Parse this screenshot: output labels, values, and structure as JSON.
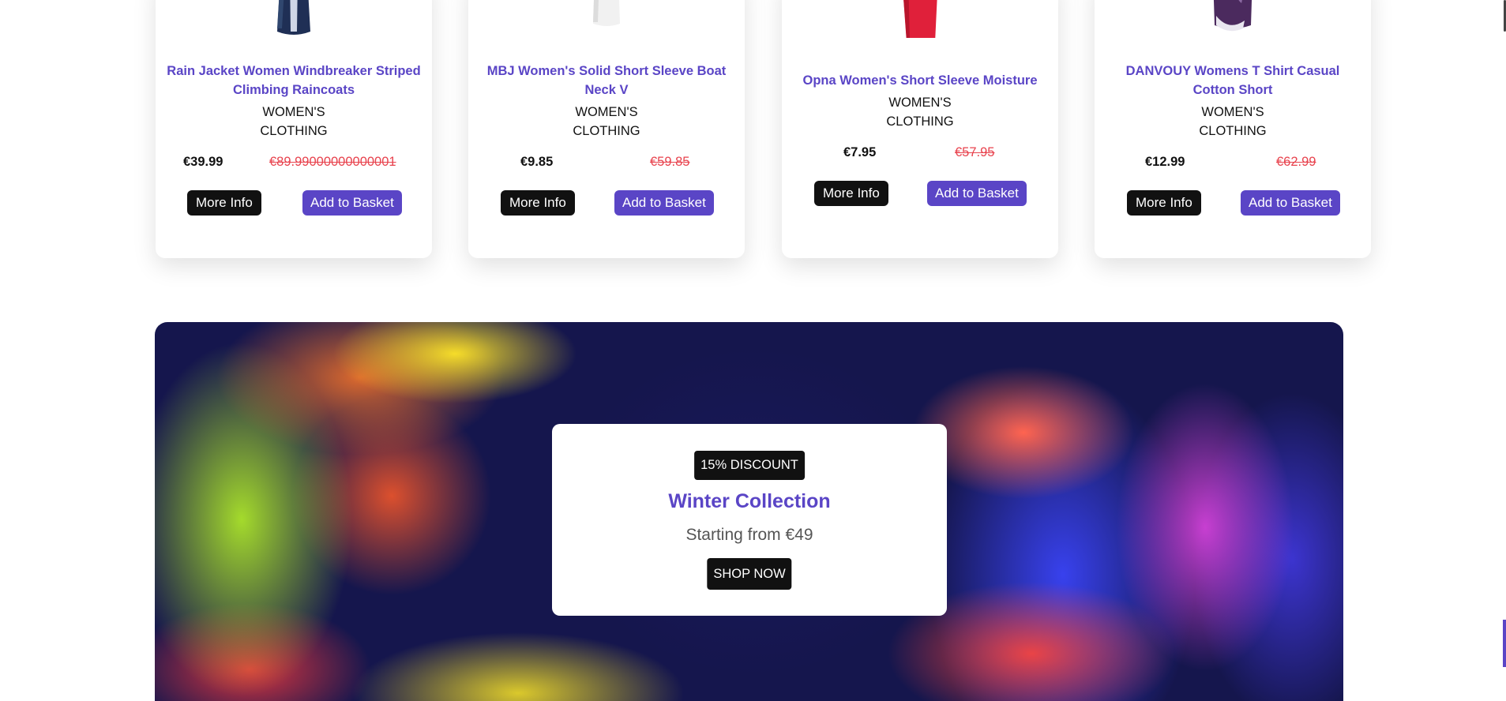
{
  "products": [
    {
      "title": "Rain Jacket Women Windbreaker Striped Climbing Raincoats",
      "category": "WOMEN'S\nCLOTHING",
      "price": "€39.99",
      "old_price": "€89.99000000000001",
      "more_label": "More Info",
      "basket_label": "Add to Basket"
    },
    {
      "title": "MBJ Women's Solid Short Sleeve Boat Neck V",
      "category": "WOMEN'S\nCLOTHING",
      "price": "€9.85",
      "old_price": "€59.85",
      "more_label": "More Info",
      "basket_label": "Add to Basket"
    },
    {
      "title": "Opna Women's Short Sleeve Moisture",
      "category": "WOMEN'S\nCLOTHING",
      "price": "€7.95",
      "old_price": "€57.95",
      "more_label": "More Info",
      "basket_label": "Add to Basket"
    },
    {
      "title": "DANVOUY Womens T Shirt Casual Cotton Short",
      "category": "WOMEN'S\nCLOTHING",
      "price": "€12.99",
      "old_price": "€62.99",
      "more_label": "More Info",
      "basket_label": "Add to Basket"
    }
  ],
  "promo": {
    "badge": "15% DISCOUNT",
    "headline": "Winter Collection",
    "subline": "Starting from €49",
    "cta": "SHOP NOW"
  },
  "colors": {
    "accent": "#5a45c6",
    "sale": "#e8434e",
    "dark": "#111111"
  }
}
